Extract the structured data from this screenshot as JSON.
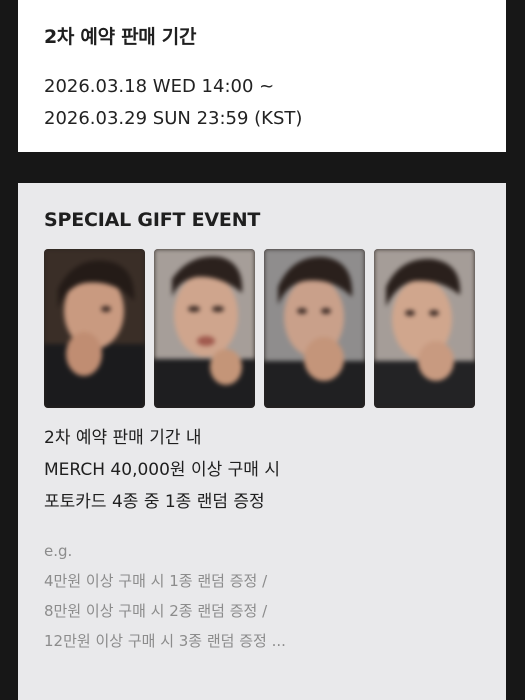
{
  "sales": {
    "title": "2차 예약 판매 기간",
    "period_line1": "2026.03.18 WED 14:00 ~",
    "period_line2": "2026.03.29 SUN 23:59 (KST)"
  },
  "gift": {
    "title": "SPECIAL GIFT EVENT",
    "photocards": [
      {
        "name": "photocard-1"
      },
      {
        "name": "photocard-2"
      },
      {
        "name": "photocard-3"
      },
      {
        "name": "photocard-4"
      }
    ],
    "description": [
      "2차 예약 판매 기간 내",
      "MERCH 40,000원 이상 구매 시",
      "포토카드 4종 중 1종 랜덤 증정"
    ],
    "example": [
      "e.g.",
      "4만원 이상 구매 시 1종 랜덤 증정 /",
      "8만원 이상 구매 시 2종 랜덤 증정 /",
      "12만원 이상 구매 시 3종 랜덤 증정 ..."
    ]
  },
  "colors": {
    "background": "#171717",
    "card_top": "#ffffff",
    "card_gift": "#e9e9eb",
    "muted_text": "#8c8c8c"
  }
}
